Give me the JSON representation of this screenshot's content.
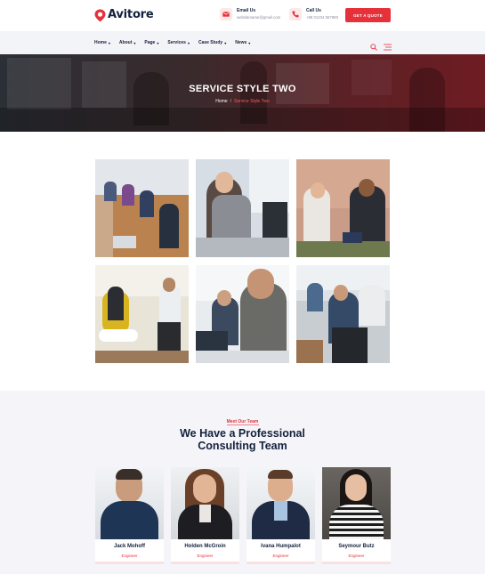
{
  "brand": {
    "name": "Avitore",
    "accent": "#e6313b",
    "navy": "#14213d"
  },
  "header": {
    "email": {
      "title": "Email Us",
      "value": "websitename@gmail.com"
    },
    "call": {
      "title": "Call Us",
      "value": "+88 01234 567890"
    },
    "quote_button": "GET A QUOTE"
  },
  "nav": {
    "items": [
      {
        "label": "Home"
      },
      {
        "label": "About"
      },
      {
        "label": "Page"
      },
      {
        "label": "Services"
      },
      {
        "label": "Case Study"
      },
      {
        "label": "News"
      }
    ],
    "icons": [
      "search-icon",
      "menu-icon"
    ]
  },
  "banner": {
    "title": "SERVICE STYLE TWO",
    "breadcrumb_home": "Home",
    "breadcrumb_sep": "/",
    "breadcrumb_current": "Service Style Two"
  },
  "team": {
    "subtitle": "Meet Our Team",
    "title_line1": "We Have a Professional",
    "title_line2": "Consulting Team",
    "members": [
      {
        "name": "Jack Mohoff",
        "role": "Engineer"
      },
      {
        "name": "Holden McGroin",
        "role": "Engineer"
      },
      {
        "name": "Ivana Humpalot",
        "role": "Engineer"
      },
      {
        "name": "Seymour Butz",
        "role": "Engineer"
      }
    ]
  }
}
